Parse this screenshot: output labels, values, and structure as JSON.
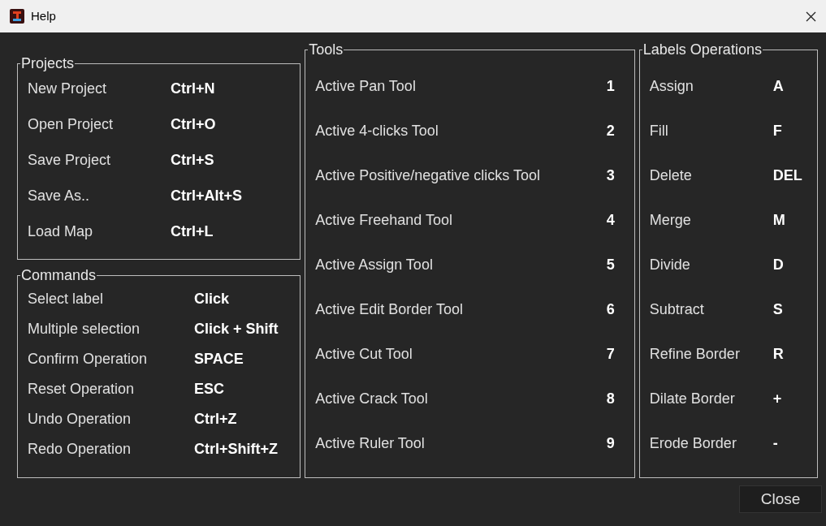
{
  "window": {
    "title": "Help"
  },
  "groups": [
    {
      "title": "Projects",
      "kind": "projects",
      "rows": [
        {
          "action": "New Project",
          "key": "Ctrl+N"
        },
        {
          "action": "Open Project",
          "key": "Ctrl+O"
        },
        {
          "action": "Save Project",
          "key": "Ctrl+S"
        },
        {
          "action": "Save As..",
          "key": "Ctrl+Alt+S"
        },
        {
          "action": "Load Map",
          "key": "Ctrl+L"
        }
      ]
    },
    {
      "title": "Commands",
      "kind": "commands",
      "rows": [
        {
          "action": "Select label",
          "key": "Click"
        },
        {
          "action": "Multiple selection",
          "key": "Click + Shift"
        },
        {
          "action": "Confirm Operation",
          "key": "SPACE"
        },
        {
          "action": "Reset Operation",
          "key": "ESC"
        },
        {
          "action": "Undo Operation",
          "key": "Ctrl+Z"
        },
        {
          "action": "Redo Operation",
          "key": "Ctrl+Shift+Z"
        }
      ]
    },
    {
      "title": "Tools",
      "kind": "tools",
      "rows": [
        {
          "action": "Active Pan Tool",
          "key": "1"
        },
        {
          "action": "Active 4-clicks Tool",
          "key": "2"
        },
        {
          "action": "Active Positive/negative clicks Tool",
          "key": "3"
        },
        {
          "action": "Active Freehand Tool",
          "key": "4"
        },
        {
          "action": "Active Assign Tool",
          "key": "5"
        },
        {
          "action": "Active Edit Border Tool",
          "key": "6"
        },
        {
          "action": "Active Cut Tool",
          "key": "7"
        },
        {
          "action": "Active Crack Tool",
          "key": "8"
        },
        {
          "action": "Active Ruler Tool",
          "key": "9"
        }
      ]
    },
    {
      "title": "Labels Operations",
      "kind": "labels",
      "rows": [
        {
          "action": "Assign",
          "key": "A"
        },
        {
          "action": "Fill",
          "key": "F"
        },
        {
          "action": "Delete",
          "key": "DEL"
        },
        {
          "action": "Merge",
          "key": "M"
        },
        {
          "action": "Divide",
          "key": "D"
        },
        {
          "action": "Subtract",
          "key": "S"
        },
        {
          "action": "Refine Border",
          "key": "R"
        },
        {
          "action": "Dilate Border",
          "key": "+"
        },
        {
          "action": "Erode Border",
          "key": "-"
        }
      ]
    }
  ],
  "buttons": [
    {
      "label": "Close"
    }
  ]
}
